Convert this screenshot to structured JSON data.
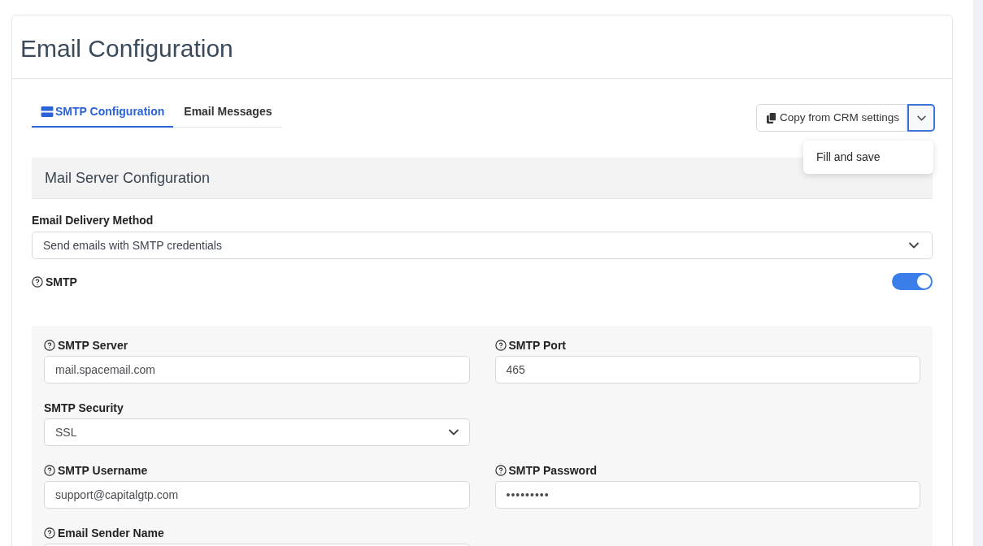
{
  "page": {
    "title": "Email Configuration"
  },
  "tabs": [
    {
      "label": "SMTP Configuration",
      "selected": true,
      "kind": "server"
    },
    {
      "label": "Email Messages",
      "selected": false,
      "kind": "plain"
    }
  ],
  "copy_button": {
    "label": "Copy from CRM settings"
  },
  "dropdown_menu": {
    "open": true,
    "items": [
      "Fill and save"
    ]
  },
  "section": {
    "title": "Mail Server Configuration"
  },
  "delivery_method": {
    "label": "Email Delivery Method",
    "value": "Send emails with SMTP credentials"
  },
  "smtp_toggle": {
    "label": "SMTP",
    "help": true,
    "on": true
  },
  "form_rows": [
    [
      {
        "kind": "text",
        "label": "SMTP Server",
        "help": true,
        "value": "mail.spacemail.com"
      },
      {
        "kind": "text",
        "label": "SMTP Port",
        "help": true,
        "value": "465"
      }
    ],
    [
      {
        "kind": "select",
        "label": "SMTP Security",
        "help": false,
        "value": "SSL"
      }
    ],
    [
      {
        "kind": "text",
        "label": "SMTP Username",
        "help": true,
        "value": "support@capitalgtp.com"
      },
      {
        "kind": "password",
        "label": "SMTP Password",
        "help": true,
        "value": "•••••••••"
      }
    ],
    [
      {
        "kind": "text",
        "label": "Email Sender Name",
        "help": true
      }
    ]
  ]
}
